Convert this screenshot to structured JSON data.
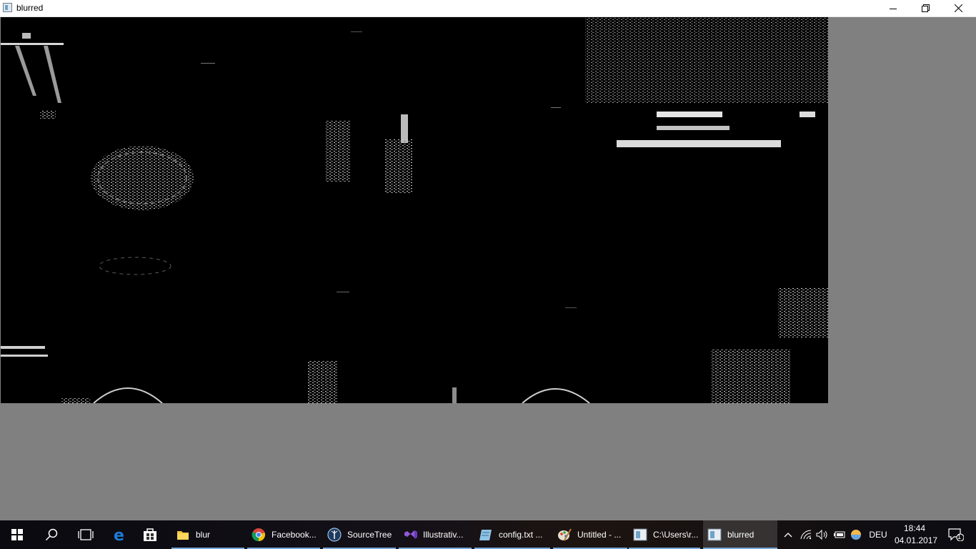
{
  "window": {
    "title": "blurred",
    "minimize_icon": "minimize-icon",
    "restore_icon": "restore-icon",
    "close_icon": "close-icon"
  },
  "colors": {
    "desktop_bg": "#808080",
    "canvas_bg": "#000000",
    "taskbar_active_underline": "#7aa8d8"
  },
  "taskbar": {
    "pinned_icons": [
      "windows-start-icon",
      "search-icon",
      "task-view-icon",
      "edge-icon",
      "store-icon"
    ],
    "apps": [
      {
        "label": "blur",
        "icon": "folder-icon"
      },
      {
        "label": "Facebook...",
        "icon": "chrome-icon"
      },
      {
        "label": "SourceTree",
        "icon": "sourcetree-icon"
      },
      {
        "label": "Illustrativ...",
        "icon": "visual-studio-icon"
      },
      {
        "label": "config.txt ...",
        "icon": "notepad-icon"
      },
      {
        "label": "Untitled - ...",
        "icon": "paint-icon"
      },
      {
        "label": "C:\\Users\\r...",
        "icon": "console-window-icon"
      },
      {
        "label": "blurred",
        "icon": "image-window-icon"
      }
    ],
    "tray": {
      "language": "DEU",
      "time": "18:44",
      "date": "04.01.2017",
      "notification_count": "1"
    }
  }
}
